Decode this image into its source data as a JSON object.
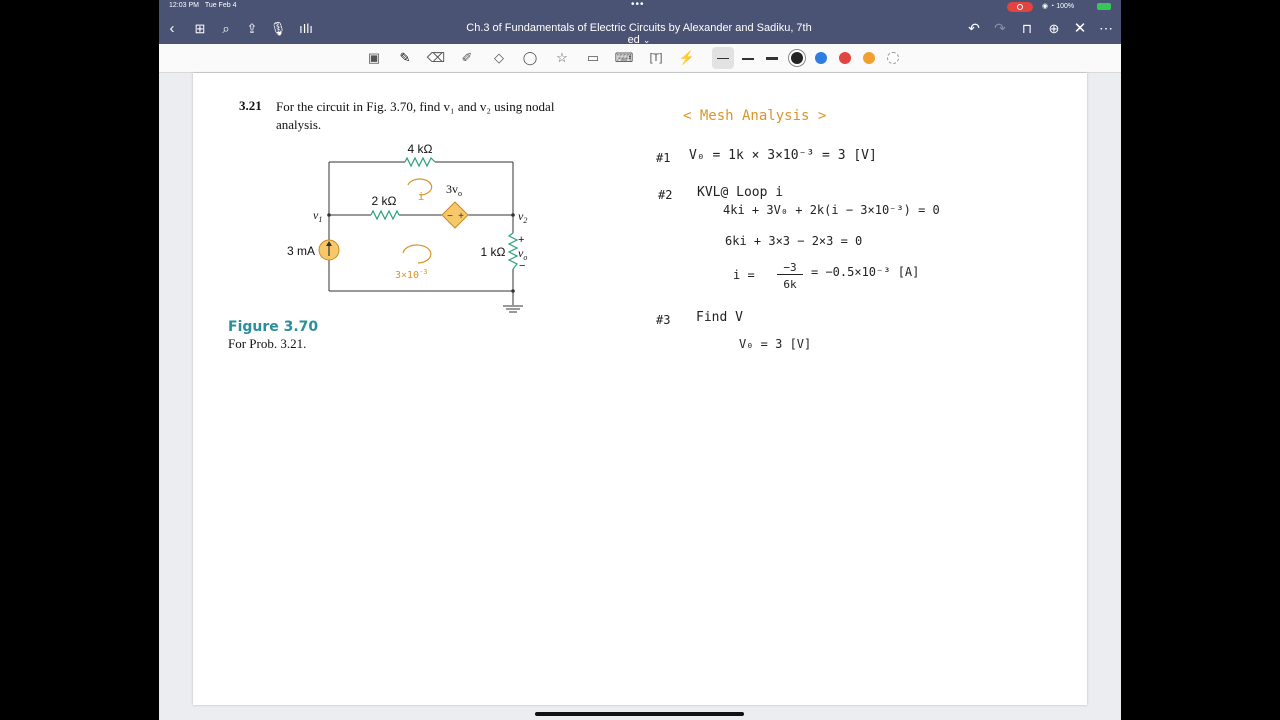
{
  "status_bar": {
    "time": "12:03 PM",
    "date": "Tue Feb 4",
    "battery": "100%"
  },
  "nav": {
    "title": "Ch.3 of Fundamentals of Electric Circuits by Alexander and Sadiku, 7th ed",
    "title_chevron": "⌄",
    "left_icons": [
      "back-icon",
      "grid-icon",
      "search-icon",
      "share-icon",
      "microphone-icon",
      "audio-wave-icon"
    ],
    "right_icons": [
      "undo-icon",
      "redo-icon",
      "bookmark-icon",
      "add-page-icon",
      "close-icon",
      "more-icon"
    ]
  },
  "toolbar": {
    "tools": [
      "image-tool-icon",
      "pen-icon",
      "eraser-icon",
      "highlighter-icon",
      "shapes-icon",
      "lasso-icon",
      "sticker-icon",
      "photo-icon",
      "keyboard-icon",
      "text-icon",
      "laser-pointer-icon"
    ],
    "colors": [
      "#222222",
      "#2f7de0",
      "#e2443f",
      "#f0a030"
    ]
  },
  "problem": {
    "number": "3.21",
    "text": "For the circuit in Fig. 3.70, find v₁ and v₂ using nodal analysis."
  },
  "figure": {
    "resistor_top": "4 kΩ",
    "resistor_mid": "2 kΩ",
    "resistor_right": "1 kΩ",
    "dependent_source": "3v",
    "dependent_source_sub": "o",
    "current_source": "3 mA",
    "node_v1": "v",
    "node_v1_sub": "1",
    "node_v2": "v",
    "node_v2_sub": "2",
    "vo_plus": "+",
    "vo_label": "v",
    "vo_sub": "o",
    "vo_minus": "−",
    "source_minus": "−",
    "source_plus": "+",
    "annot_mesh_top": "i",
    "annot_mesh_bottom": "3×10",
    "annot_mesh_bottom_exp": "-3",
    "caption_title": "Figure 3.70",
    "caption_text": "For Prob. 3.21."
  },
  "notes": {
    "heading": "< Mesh Analysis >",
    "l1_label": "#1",
    "l1": "V₀ = 1k × 3×10⁻³ = 3 [V]",
    "l2_label": "#2",
    "l2": "KVL@ Loop i",
    "l3": "4ki + 3V₀ + 2k(i − 3×10⁻³) = 0",
    "l4": "6ki + 3×3 − 2×3 = 0",
    "l5_left": "i =",
    "l5_num": "−3",
    "l5_den": "6k",
    "l5_right": "= −0.5×10⁻³ [A]",
    "l6_label": "#3",
    "l6": "Find V",
    "l7": "V₀ = 3 [V]"
  }
}
